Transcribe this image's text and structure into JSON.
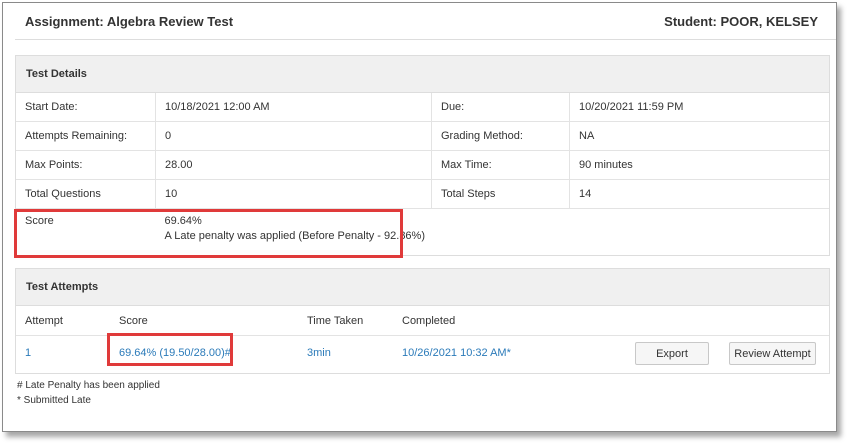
{
  "header": {
    "assignment": "Assignment: Algebra Review Test",
    "student": "Student: POOR, KELSEY"
  },
  "details": {
    "title": "Test Details",
    "rows": [
      {
        "l1": "Start Date:",
        "v1": "10/18/2021 12:00 AM",
        "l2": "Due:",
        "v2": "10/20/2021 11:59 PM"
      },
      {
        "l1": "Attempts Remaining:",
        "v1": "0",
        "l2": "Grading Method:",
        "v2": "NA"
      },
      {
        "l1": "Max Points:",
        "v1": "28.00",
        "l2": "Max Time:",
        "v2": "90 minutes"
      },
      {
        "l1": "Total Questions",
        "v1": "10",
        "l2": "Total Steps",
        "v2": "14"
      }
    ],
    "score_label": "Score",
    "score_value": "69.64%",
    "score_note": "A Late penalty was applied (Before Penalty - 92.86%)"
  },
  "attempts": {
    "title": "Test Attempts",
    "columns": {
      "attempt": "Attempt",
      "score": "Score",
      "time": "Time Taken",
      "completed": "Completed"
    },
    "row": {
      "attempt": "1",
      "score": "69.64% (19.50/28.00)#",
      "time": "3min",
      "completed": "10/26/2021 10:32 AM*",
      "export_label": "Export",
      "review_label": "Review Attempt"
    }
  },
  "footnotes": {
    "late": "# Late Penalty has been applied",
    "submitted": "* Submitted Late"
  },
  "colors": {
    "link": "#2a7ab9",
    "highlight": "#e03a3a"
  }
}
